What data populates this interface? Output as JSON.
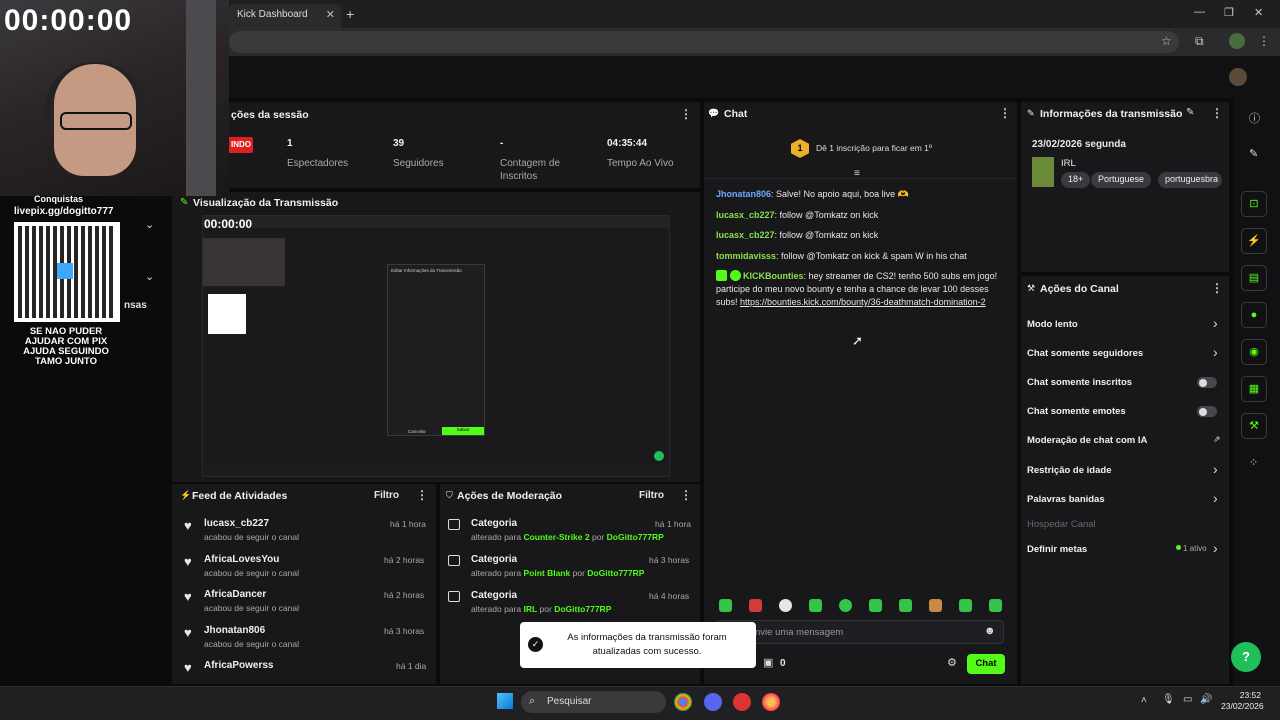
{
  "browser": {
    "tab_title": "Kick Dashboard",
    "tab_close": "✕",
    "new_tab": "+",
    "window_controls": [
      "—",
      "❐",
      "✕"
    ]
  },
  "webcam_overlay": {
    "timer": "00:00:00",
    "conquistas_label": "Conquistas",
    "pix_url": "livepix.gg/dogitto777",
    "pix_message": "SE NAO PUDER AJUDAR COM PIX AJUDA SEGUINDO TAMO JUNTO",
    "truncated_label": "nsas"
  },
  "session": {
    "title": "ções da sessão",
    "live_label": "INDO",
    "stats": [
      {
        "value": "1",
        "label": "Espectadores"
      },
      {
        "value": "39",
        "label": "Seguidores"
      },
      {
        "value": "-",
        "label": "Contagem de Inscritos"
      },
      {
        "value": "04:35:44",
        "label": "Tempo Ao Vivo"
      }
    ]
  },
  "preview": {
    "title": "Visualização da Transmissão",
    "inner_timer": "00:00:00",
    "dialog_title": "Editar Informações da Transmissão",
    "dialog_cancel": "Cancelar",
    "dialog_save": "Salvar"
  },
  "feed": {
    "title": "Feed de Atividades",
    "filter": "Filtro",
    "items": [
      {
        "user": "lucasx_cb227",
        "action": "acabou de seguir o canal",
        "time": "há 1 hora"
      },
      {
        "user": "AfricaLovesYou",
        "action": "acabou de seguir o canal",
        "time": "há 2 horas"
      },
      {
        "user": "AfricaDancer",
        "action": "acabou de seguir o canal",
        "time": "há 2 horas"
      },
      {
        "user": "Jhonatan806",
        "action": "acabou de seguir o canal",
        "time": "há 3 horas"
      },
      {
        "user": "AfricaPowerss",
        "action": "",
        "time": "há 1 dia"
      }
    ]
  },
  "moderation": {
    "title": "Ações de Moderação",
    "filter": "Filtro",
    "items": [
      {
        "title": "Categoria",
        "prefix": "alterado para",
        "target": "Counter-Strike 2",
        "by": "por",
        "moderator": "DoGitto777RP",
        "time": "há 1 hora"
      },
      {
        "title": "Categoria",
        "prefix": "alterado para",
        "target": "Point Blank",
        "by": "por",
        "moderator": "DoGitto777RP",
        "time": "há 3 horas"
      },
      {
        "title": "Categoria",
        "prefix": "alterado para",
        "target": "IRL",
        "by": "por",
        "moderator": "DoGitto777RP",
        "time": "há 4 horas"
      }
    ]
  },
  "chat": {
    "title": "Chat",
    "sub_banner": "Dê 1 inscrição para ficar em 1º",
    "badge_number": "1",
    "messages": [
      {
        "user": "Jhonatan806",
        "text": ": Salve! No apoio aqui, boa live 🫶",
        "color": "blue"
      },
      {
        "user": "lucasx_cb227",
        "text": ": follow @Tomkatz on kick",
        "color": "green"
      },
      {
        "user": "lucasx_cb227",
        "text": ": follow @Tomkatz on kick",
        "color": "green"
      },
      {
        "user": "tommidavisss",
        "text": ": follow @Tomkatz on kick & spam W in his chat",
        "color": "green"
      },
      {
        "user": "KICKBounties",
        "text": ": hey streamer de CS2! tenho 500 subs em jogo! participe do meu novo bounty e tenha a chance de levar 100 desses subs!",
        "link": "https://bounties.kick.com/bounty/36-deathmatch-domination-2",
        "color": "green"
      }
    ],
    "input_placeholder": "nvie uma mensagem",
    "sub_count": "0",
    "send_button": "Chat"
  },
  "toast": {
    "message": "As informações da transmissão foram atualizadas com sucesso."
  },
  "info": {
    "title": "Informações da transmissão",
    "date": "23/02/2026 segunda",
    "category": "IRL",
    "tags": [
      "18+",
      "Portuguese",
      "portuguesbra"
    ]
  },
  "actions": {
    "title": "Ações do Canal",
    "items": [
      {
        "label": "Modo lento",
        "control": "chevron"
      },
      {
        "label": "Chat somente seguidores",
        "control": "chevron"
      },
      {
        "label": "Chat somente inscritos",
        "control": "toggle"
      },
      {
        "label": "Chat somente emotes",
        "control": "toggle"
      },
      {
        "label": "Moderação de chat com IA",
        "control": "external"
      },
      {
        "label": "Restrição de idade",
        "control": "chevron"
      },
      {
        "label": "Palavras banidas",
        "control": "chevron"
      },
      {
        "label": "Hospedar Canal",
        "control": "none",
        "disabled": true
      },
      {
        "label": "Definir metas",
        "control": "chevron",
        "extra": "1 ativo"
      }
    ]
  },
  "taskbar": {
    "search_placeholder": "Pesquisar",
    "time": "23:52",
    "date": "23/02/2026"
  },
  "colors": {
    "accent": "#53fc18",
    "panel": "#18181b",
    "background": "#0b0b0c",
    "live_red": "#e01f1f"
  }
}
